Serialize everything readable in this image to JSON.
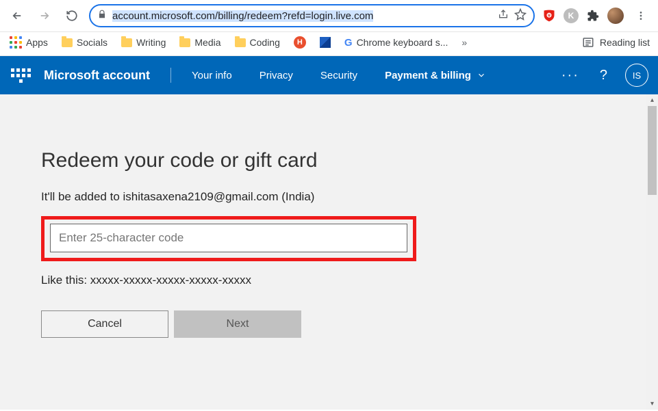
{
  "browser": {
    "url": "account.microsoft.com/billing/redeem?refd=login.live.com"
  },
  "bookmarks": {
    "apps": "Apps",
    "items": [
      "Socials",
      "Writing",
      "Media",
      "Coding"
    ],
    "chopped": "Chrome keyboard s...",
    "reading": "Reading list"
  },
  "nav": {
    "brand": "Microsoft account",
    "links": {
      "info": "Your info",
      "privacy": "Privacy",
      "security": "Security",
      "payment": "Payment & billing"
    },
    "avatar": "IS"
  },
  "page": {
    "title": "Redeem your code or gift card",
    "subtitle": "It'll be added to ishitasaxena2109@gmail.com (India)",
    "placeholder": "Enter 25-character code",
    "example": "Like this: xxxxx-xxxxx-xxxxx-xxxxx-xxxxx",
    "cancel": "Cancel",
    "next": "Next"
  }
}
